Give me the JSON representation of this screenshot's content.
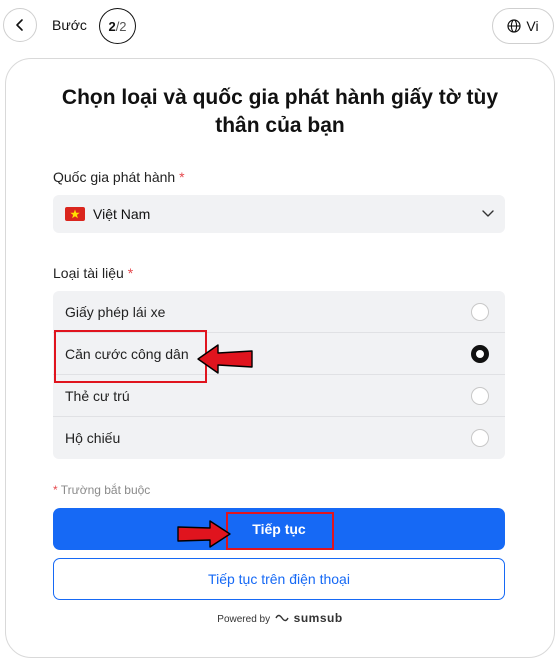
{
  "header": {
    "step_label": "Bước",
    "step_current": "2",
    "step_total": "/2",
    "language": "Vi"
  },
  "title": "Chọn loại và quốc gia phát hành giấy tờ tùy thân của bạn",
  "country": {
    "label": "Quốc gia phát hành",
    "required_mark": "*",
    "value": "Việt Nam"
  },
  "document": {
    "label": "Loại tài liệu",
    "required_mark": "*",
    "options": [
      {
        "label": "Giấy phép lái xe",
        "selected": false
      },
      {
        "label": "Căn cước công dân",
        "selected": true
      },
      {
        "label": "Thẻ cư trú",
        "selected": false
      },
      {
        "label": "Hộ chiếu",
        "selected": false
      }
    ]
  },
  "required_note": {
    "mark": "*",
    "text": "Trường bắt buộc"
  },
  "buttons": {
    "continue": "Tiếp tục",
    "continue_phone": "Tiếp tục trên điện thoại"
  },
  "footer": {
    "powered_by": "Powered by",
    "brand": "sumsub"
  },
  "colors": {
    "primary": "#1669f5",
    "required": "#e5484d",
    "highlight": "#e0141e"
  }
}
